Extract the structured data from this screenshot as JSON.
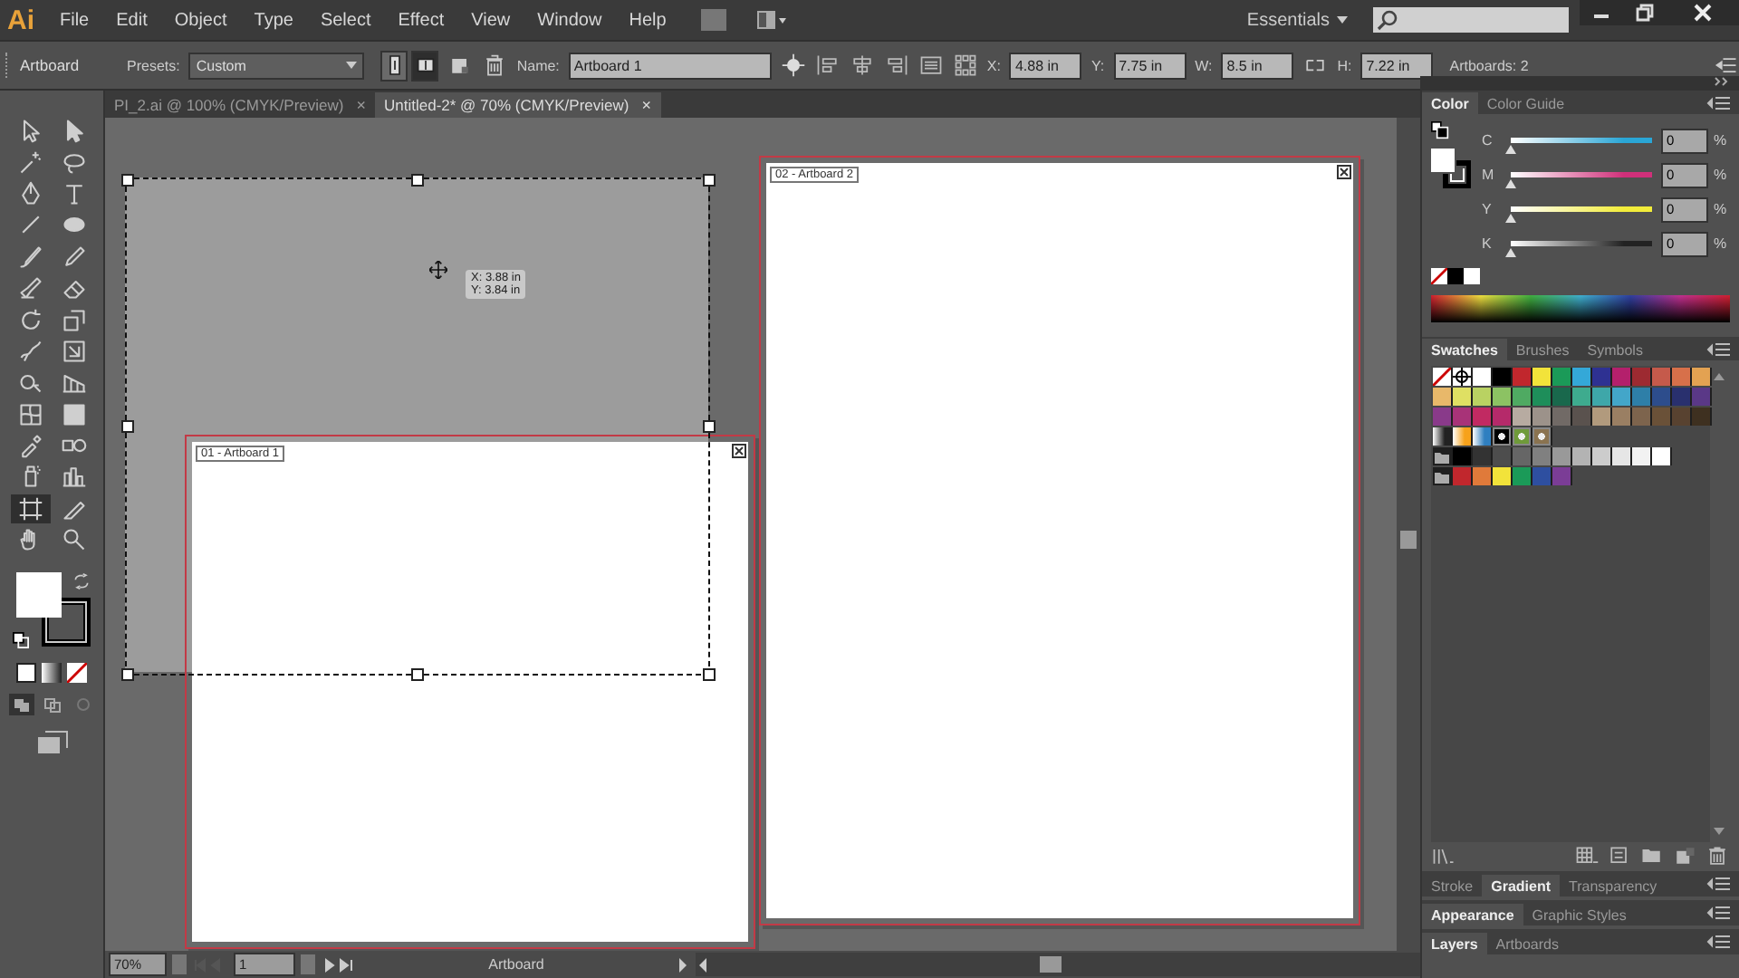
{
  "menu_bar": {
    "logo": "Ai",
    "items": [
      "File",
      "Edit",
      "Object",
      "Type",
      "Select",
      "Effect",
      "View",
      "Window",
      "Help"
    ],
    "workspace": "Essentials"
  },
  "control_bar": {
    "mode": "Artboard",
    "presets_label": "Presets:",
    "preset": "Custom",
    "orientations": [
      {
        "selected": false
      },
      {
        "selected": true
      }
    ],
    "name_label": "Name:",
    "name": "Artboard 1",
    "fields": [
      {
        "label": "X:",
        "value": "4.88 in"
      },
      {
        "label": "Y:",
        "value": "7.75 in"
      },
      {
        "label": "W:",
        "value": "8.5 in"
      },
      {
        "label": "H:",
        "value": "7.22 in"
      }
    ],
    "artboards_count": "Artboards: 2"
  },
  "document_tabs": [
    {
      "label": "PI_2.ai @ 100% (CMYK/Preview)",
      "close": "×",
      "selected": false
    },
    {
      "label": "Untitled-2* @ 70% (CMYK/Preview)",
      "close": "×",
      "selected": true
    }
  ],
  "tools": [
    {
      "selected": false
    },
    {
      "selected": false
    },
    {
      "selected": false
    },
    {
      "selected": false
    },
    {
      "selected": false
    },
    {
      "selected": false
    },
    {
      "selected": false
    },
    {
      "selected": false
    },
    {
      "selected": false
    },
    {
      "selected": false
    },
    {
      "selected": false
    },
    {
      "selected": false
    },
    {
      "selected": false
    },
    {
      "selected": false
    },
    {
      "selected": false
    },
    {
      "selected": false
    },
    {
      "selected": false
    },
    {
      "selected": false
    },
    {
      "selected": false
    },
    {
      "selected": false
    },
    {
      "selected": false
    },
    {
      "selected": false
    },
    {
      "selected": false
    },
    {
      "selected": false
    },
    {
      "selected": true
    },
    {
      "selected": false
    },
    {
      "selected": false
    },
    {
      "selected": false
    }
  ],
  "canvas": {
    "artboards": [
      {
        "label": "01 - Artboard 1"
      },
      {
        "label": "02 - Artboard 2"
      }
    ],
    "tooltip": [
      "X: 3.88 in",
      "Y: 3.84 in"
    ]
  },
  "color_panel": {
    "tabs": [
      {
        "label": "Color",
        "selected": true
      },
      {
        "label": "Color Guide",
        "selected": false
      }
    ],
    "channels": [
      {
        "name": "C",
        "value": "0",
        "unit": "%",
        "level": 0,
        "color": "#2aa6d6"
      },
      {
        "name": "M",
        "value": "0",
        "unit": "%",
        "level": 0,
        "color": "#d0307a"
      },
      {
        "name": "Y",
        "value": "0",
        "unit": "%",
        "level": 0,
        "color": "#f2ec3a"
      },
      {
        "name": "K",
        "value": "0",
        "unit": "%",
        "level": 0,
        "color": "#222222"
      }
    ]
  },
  "swatches_panel": {
    "tabs": [
      {
        "label": "Swatches",
        "selected": true
      },
      {
        "label": "Brushes",
        "selected": false
      },
      {
        "label": "Symbols",
        "selected": false
      }
    ],
    "rows": [
      [
        {
          "kind": "none"
        },
        {
          "kind": "registration"
        },
        {
          "kind": "color",
          "color": "#ffffff"
        },
        {
          "kind": "color",
          "color": "#000000"
        },
        {
          "kind": "color",
          "color": "#c1272d"
        },
        {
          "kind": "color",
          "color": "#f2e33a"
        },
        {
          "kind": "color",
          "color": "#1b9a58"
        },
        {
          "kind": "color",
          "color": "#34a8d8"
        },
        {
          "kind": "color",
          "color": "#2e3192"
        },
        {
          "kind": "color",
          "color": "#b4206c"
        },
        {
          "kind": "color",
          "color": "#9d2a31"
        },
        {
          "kind": "color",
          "color": "#c55a4b"
        },
        {
          "kind": "color",
          "color": "#d7704a"
        },
        {
          "kind": "color",
          "color": "#e3a252"
        }
      ],
      [
        {
          "kind": "color",
          "color": "#e8b86a"
        },
        {
          "kind": "color",
          "color": "#dfe063"
        },
        {
          "kind": "color",
          "color": "#b9d262"
        },
        {
          "kind": "color",
          "color": "#8cc263"
        },
        {
          "kind": "color",
          "color": "#4faa62"
        },
        {
          "kind": "color",
          "color": "#1e8e5a"
        },
        {
          "kind": "color",
          "color": "#19684c"
        },
        {
          "kind": "color",
          "color": "#3eab8e"
        },
        {
          "kind": "color",
          "color": "#3ea7a9"
        },
        {
          "kind": "color",
          "color": "#43a6c9"
        },
        {
          "kind": "color",
          "color": "#2e7fa8"
        },
        {
          "kind": "color",
          "color": "#2d4d8c"
        },
        {
          "kind": "color",
          "color": "#29306e"
        },
        {
          "kind": "color",
          "color": "#5a3887"
        }
      ],
      [
        {
          "kind": "color",
          "color": "#893a8a"
        },
        {
          "kind": "color",
          "color": "#a83378"
        },
        {
          "kind": "color",
          "color": "#c12a62"
        },
        {
          "kind": "color",
          "color": "#b52a6a"
        },
        {
          "kind": "color",
          "color": "#b7aba1"
        },
        {
          "kind": "color",
          "color": "#9c928a"
        },
        {
          "kind": "color",
          "color": "#716a66"
        },
        {
          "kind": "color",
          "color": "#5a524e"
        },
        {
          "kind": "color",
          "color": "#b19a7d"
        },
        {
          "kind": "color",
          "color": "#9a7f63"
        },
        {
          "kind": "color",
          "color": "#7d644d"
        },
        {
          "kind": "color",
          "color": "#6a5138"
        },
        {
          "kind": "color",
          "color": "#584230"
        },
        {
          "kind": "color",
          "color": "#3e3020"
        }
      ],
      [
        {
          "kind": "gradient",
          "color": "#222222"
        },
        {
          "kind": "gradient",
          "color": "#f7a21b"
        },
        {
          "kind": "gradient",
          "color": "#2f7fc0"
        },
        {
          "kind": "pattern",
          "color": "#000000"
        },
        {
          "kind": "pattern",
          "color": "#6f9a3a"
        },
        {
          "kind": "pattern",
          "color": "#8a7350"
        }
      ],
      [
        {
          "kind": "folder"
        },
        {
          "kind": "color",
          "color": "#000000"
        },
        {
          "kind": "color",
          "color": "#333333"
        },
        {
          "kind": "color",
          "color": "#4d4d4d"
        },
        {
          "kind": "color",
          "color": "#666666"
        },
        {
          "kind": "color",
          "color": "#808080"
        },
        {
          "kind": "color",
          "color": "#999999"
        },
        {
          "kind": "color",
          "color": "#b3b3b3"
        },
        {
          "kind": "color",
          "color": "#cccccc"
        },
        {
          "kind": "color",
          "color": "#e6e6e6"
        },
        {
          "kind": "color",
          "color": "#f2f2f2"
        },
        {
          "kind": "color",
          "color": "#ffffff"
        }
      ],
      [
        {
          "kind": "folder"
        },
        {
          "kind": "color",
          "color": "#c1272d"
        },
        {
          "kind": "color",
          "color": "#e07a3a"
        },
        {
          "kind": "color",
          "color": "#f2e33a"
        },
        {
          "kind": "color",
          "color": "#1b9a58"
        },
        {
          "kind": "color",
          "color": "#2e4fa0"
        },
        {
          "kind": "color",
          "color": "#7b3d96"
        }
      ]
    ]
  },
  "docked_groups": [
    {
      "tabs": [
        {
          "label": "Stroke",
          "selected": false
        },
        {
          "label": "Gradient",
          "selected": true
        },
        {
          "label": "Transparency",
          "selected": false
        }
      ]
    },
    {
      "tabs": [
        {
          "label": "Appearance",
          "selected": true
        },
        {
          "label": "Graphic Styles",
          "selected": false
        }
      ]
    },
    {
      "tabs": [
        {
          "label": "Layers",
          "selected": true
        },
        {
          "label": "Artboards",
          "selected": false
        }
      ]
    }
  ],
  "status_bar": {
    "zoom": "70%",
    "page": "1",
    "tool": "Artboard"
  }
}
